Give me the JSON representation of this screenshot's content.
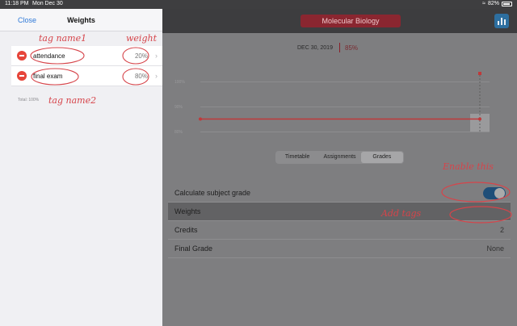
{
  "status_bar": {
    "time": "11:18 PM",
    "date": "Mon Dec 30",
    "battery": "82%"
  },
  "header": {
    "subject": "Molecular Biology"
  },
  "grade_summary": {
    "date": "DEC 30, 2019",
    "percent": "85%"
  },
  "chart_data": {
    "type": "line",
    "ylabels": [
      "100%",
      "90%",
      "80%"
    ],
    "series": [
      {
        "values": [
          85,
          85
        ]
      }
    ],
    "color": "#c0393a"
  },
  "segments": [
    "Timetable",
    "Assignments",
    "Grades"
  ],
  "settings": {
    "calculate_label": "Calculate subject grade",
    "weights_label": "Weights",
    "credits_label": "Credits",
    "credits_value": "2",
    "final_grade_label": "Final Grade",
    "final_grade_value": "None"
  },
  "popover": {
    "close_label": "Close",
    "title": "Weights",
    "items": [
      {
        "name": "attendance",
        "weight": "20%"
      },
      {
        "name": "final exam",
        "weight": "80%"
      }
    ],
    "total": "Total: 100%"
  },
  "annotations": {
    "tag1": "tag name1",
    "weight": "weight",
    "tag2": "tag name2",
    "enable": "Enable this",
    "add": "Add tags"
  },
  "colors": {
    "accent": "#2f7ad8",
    "delete": "#e6453a",
    "annotation": "#d6444a"
  }
}
